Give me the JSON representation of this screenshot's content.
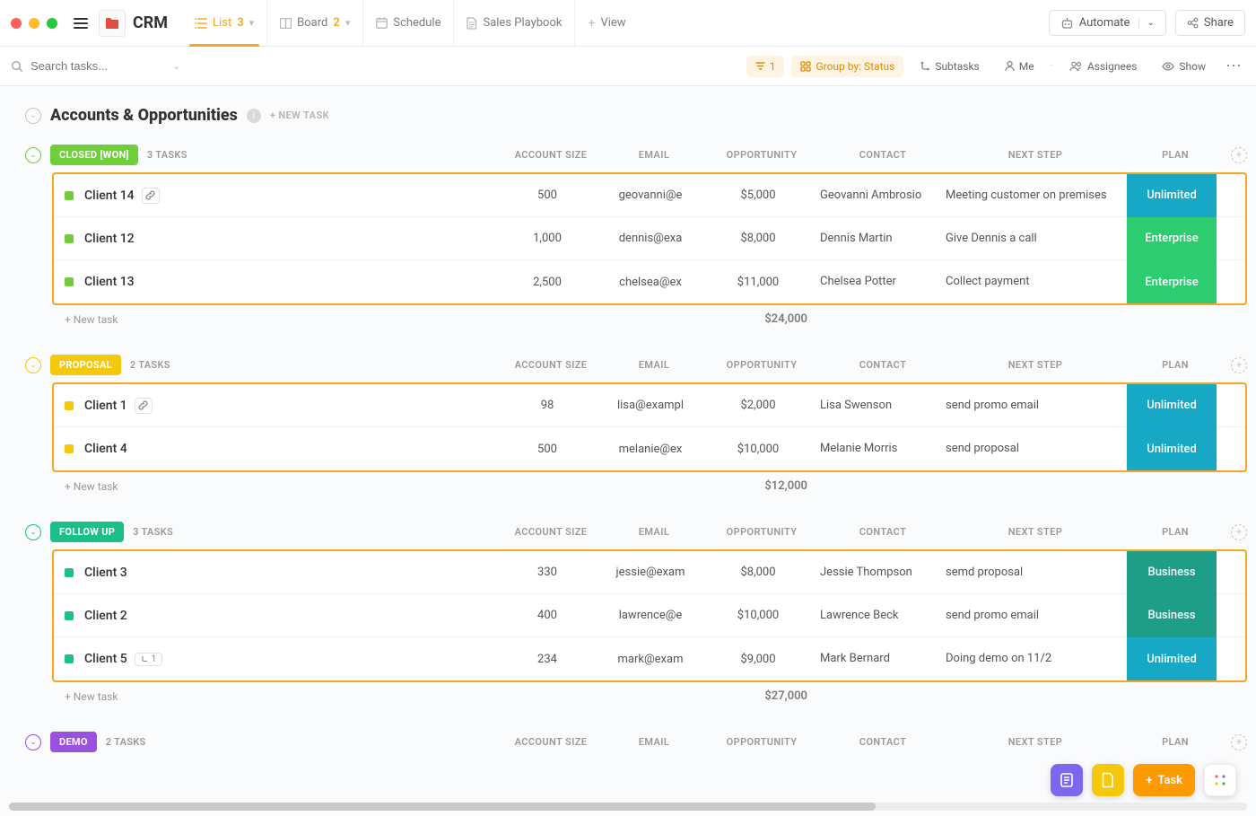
{
  "app": {
    "title": "CRM"
  },
  "views": {
    "list": {
      "label": "List",
      "count": "3"
    },
    "board": {
      "label": "Board",
      "count": "2"
    },
    "schedule": {
      "label": "Schedule"
    },
    "playbook": {
      "label": "Sales Playbook"
    },
    "addview": {
      "label": "View"
    }
  },
  "toolbar": {
    "automate": "Automate",
    "share": "Share"
  },
  "filterbar": {
    "search_placeholder": "Search tasks...",
    "filter_count": "1",
    "groupby": "Group by: Status",
    "subtasks": "Subtasks",
    "me": "Me",
    "assignees": "Assignees",
    "show": "Show"
  },
  "section": {
    "title": "Accounts & Opportunities",
    "newtask": "+ NEW TASK"
  },
  "columns": {
    "size": "ACCOUNT SIZE",
    "email": "EMAIL",
    "opp": "OPPORTUNITY",
    "contact": "CONTACT",
    "next": "NEXT STEP",
    "plan": "PLAN"
  },
  "new_task_row": "+ New task",
  "groups": [
    {
      "id": "closed",
      "label": "CLOSED [WON]",
      "color": "#6fcf3b",
      "count": "3 TASKS",
      "total": "$24,000",
      "rows": [
        {
          "name": "Client 14",
          "link": true,
          "size": "500",
          "email": "geovanni@e",
          "opp": "$5,000",
          "contact": "Geovanni Ambrosio",
          "next": "Meeting customer on premises",
          "plan": "Unlimited",
          "plan_color": "#17a8c6"
        },
        {
          "name": "Client 12",
          "size": "1,000",
          "email": "dennis@exa",
          "opp": "$8,000",
          "contact": "Dennis Martin",
          "next": "Give Dennis a call",
          "plan": "Enterprise",
          "plan_color": "#2ecc71"
        },
        {
          "name": "Client 13",
          "size": "2,500",
          "email": "chelsea@ex",
          "opp": "$11,000",
          "contact": "Chelsea Potter",
          "next": "Collect payment",
          "plan": "Enterprise",
          "plan_color": "#2ecc71"
        }
      ]
    },
    {
      "id": "proposal",
      "label": "PROPOSAL",
      "color": "#f5c90b",
      "count": "2 TASKS",
      "total": "$12,000",
      "rows": [
        {
          "name": "Client 1",
          "link": true,
          "size": "98",
          "email": "lisa@exampl",
          "opp": "$2,000",
          "contact": "Lisa Swenson",
          "next": "send promo email",
          "plan": "Unlimited",
          "plan_color": "#17a8c6"
        },
        {
          "name": "Client 4",
          "size": "500",
          "email": "melanie@ex",
          "opp": "$10,000",
          "contact": "Melanie Morris",
          "next": "send proposal",
          "plan": "Unlimited",
          "plan_color": "#17a8c6"
        }
      ]
    },
    {
      "id": "followup",
      "label": "FOLLOW UP",
      "color": "#1bbf89",
      "count": "3 TASKS",
      "total": "$27,000",
      "rows": [
        {
          "name": "Client 3",
          "size": "330",
          "email": "jessie@exam",
          "opp": "$8,000",
          "contact": "Jessie Thompson",
          "next": "semd proposal",
          "plan": "Business",
          "plan_color": "#1f9e87"
        },
        {
          "name": "Client 2",
          "size": "400",
          "email": "lawrence@e",
          "opp": "$10,000",
          "contact": "Lawrence Beck",
          "next": "send promo email",
          "plan": "Business",
          "plan_color": "#1f9e87"
        },
        {
          "name": "Client 5",
          "sub": "1",
          "size": "234",
          "email": "mark@exam",
          "opp": "$9,000",
          "contact": "Mark Bernard",
          "next": "Doing demo on 11/2",
          "plan": "Unlimited",
          "plan_color": "#17a8c6"
        }
      ]
    },
    {
      "id": "demo",
      "label": "DEMO",
      "color": "#9b51e0",
      "count": "2 TASKS",
      "total": "",
      "rows": []
    }
  ],
  "fab": {
    "task": "Task"
  }
}
